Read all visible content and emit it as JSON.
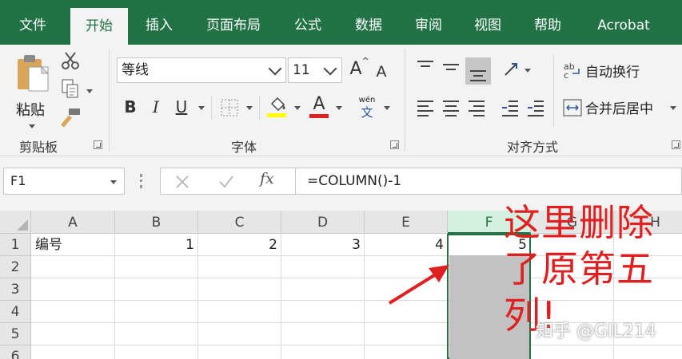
{
  "menu": {
    "items": [
      "文件",
      "开始",
      "插入",
      "页面布局",
      "公式",
      "数据",
      "审阅",
      "视图",
      "帮助",
      "Acrobat"
    ],
    "active_index": 1
  },
  "ribbon": {
    "clipboard": {
      "paste_label": "粘贴",
      "group_label": "剪贴板"
    },
    "font": {
      "font_name": "等线",
      "font_size": "11",
      "bold": "B",
      "italic": "I",
      "underline": "U",
      "grow": "A",
      "shrink": "A",
      "font_color_glyph": "A",
      "phonetic_top": "wén",
      "phonetic_bottom": "文",
      "group_label": "字体",
      "fill_color": "#ffff00",
      "font_color": "#e02020"
    },
    "alignment": {
      "wrap_text": "自动换行",
      "merge_center": "合并后居中",
      "group_label": "对齐方式"
    }
  },
  "formula_bar": {
    "name_box": "F1",
    "fx": "fx",
    "formula": "=COLUMN()-1"
  },
  "sheet": {
    "columns": [
      "A",
      "B",
      "C",
      "D",
      "E",
      "F",
      "G",
      "H"
    ],
    "selected_column": "F",
    "rows": [
      "1",
      "2",
      "3",
      "4",
      "5",
      "6"
    ],
    "row1": {
      "A": "编号",
      "B": "1",
      "C": "2",
      "D": "3",
      "E": "4",
      "F": "5"
    }
  },
  "annotation": {
    "line1": "这里删除",
    "line2": "了原第五",
    "line3": "列!",
    "color": "#e02020"
  },
  "watermark": "知乎 @GIL214",
  "colors": {
    "excel_green": "#217346",
    "ribbon_bg": "#f3f3f3"
  }
}
